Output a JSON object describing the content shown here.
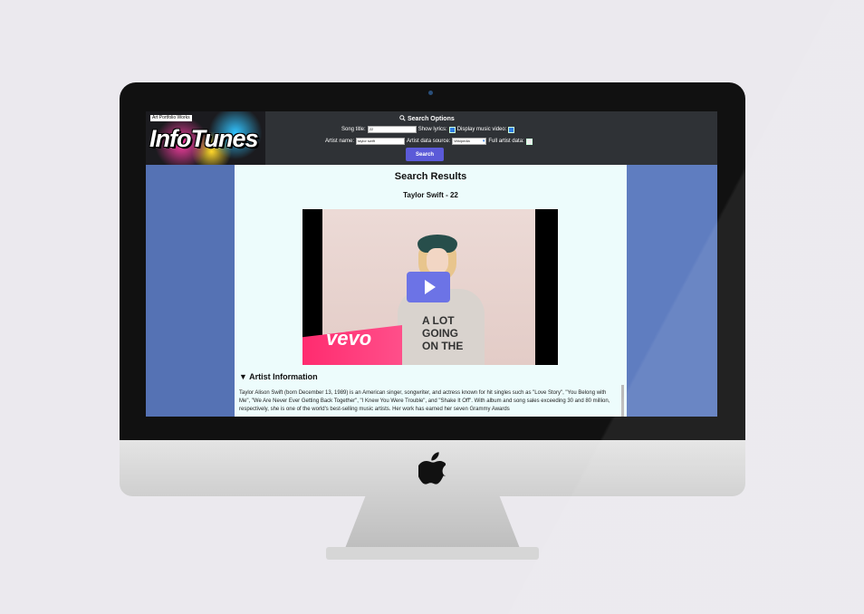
{
  "app": {
    "logo_badge": "Art Portfolio Works",
    "logo_text": "InfoTunes"
  },
  "search_options": {
    "title": "Search Options",
    "song_title_label": "Song title:",
    "song_title_value": "22",
    "show_lyrics_label": "Show lyrics:",
    "display_video_label": "Display music video:",
    "artist_name_label": "Artist name:",
    "artist_name_value": "taylor swift",
    "artist_source_label": "Artist data source:",
    "artist_source_value": "Wikipedia",
    "full_artist_label": "Full artist data:",
    "search_button": "Search"
  },
  "results": {
    "heading": "Search Results",
    "song_heading": "Taylor Swift - 22",
    "video_brand": "vevo",
    "shirt_text": "A LOT GOING ON THE",
    "artist_heading": "▼ Artist Information",
    "artist_bio": "Taylor Alison Swift (born December 13, 1989) is an American singer, songwriter, and actress known for hit singles such as \"Love Story\", \"You Belong with Me\", \"We Are Never Ever Getting Back Together\", \"I Knew You Were Trouble\", and \"Shake It Off\". With album and song sales exceeding 30 and 80 million, respectively, she is one of the world's best-selling music artists. Her work has earned her seven Grammy Awards"
  }
}
